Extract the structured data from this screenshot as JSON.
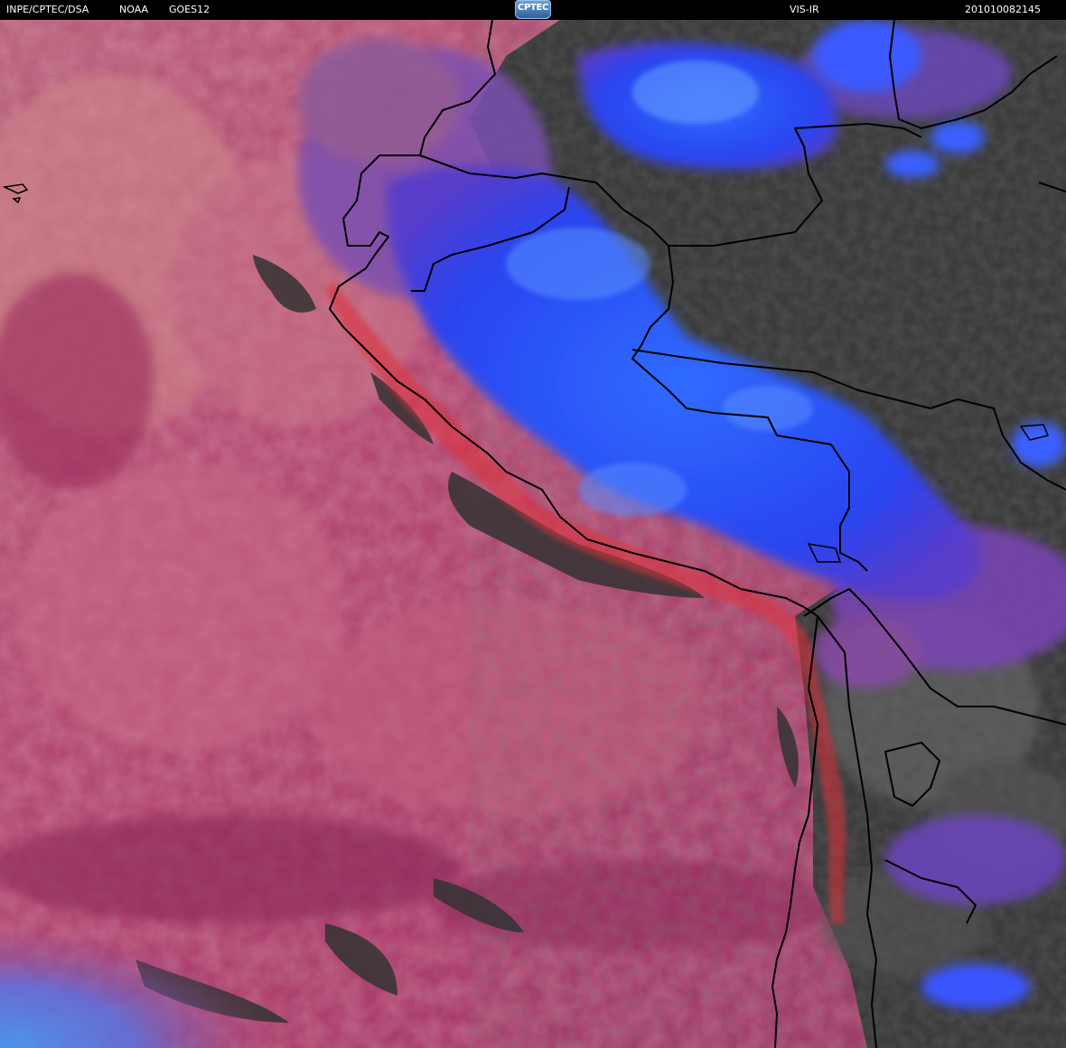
{
  "header": {
    "institution": "INPE/CPTEC/DSA",
    "agency": "NOAA",
    "satellite": "GOES12",
    "product": "VIS-IR",
    "timestamp": "201010082145"
  },
  "logo": {
    "text": "CPTEC",
    "icon": "cptec-logo"
  },
  "colors": {
    "ocean_low_cloud": "#b03a68",
    "stratocumulus": "#c06080",
    "clear_land": "#3a3a3a",
    "high_cloud": "#2a4cff",
    "mid_cloud": "#7a3fb8",
    "coastal_red": "#e0303a",
    "borders": "#000000"
  }
}
